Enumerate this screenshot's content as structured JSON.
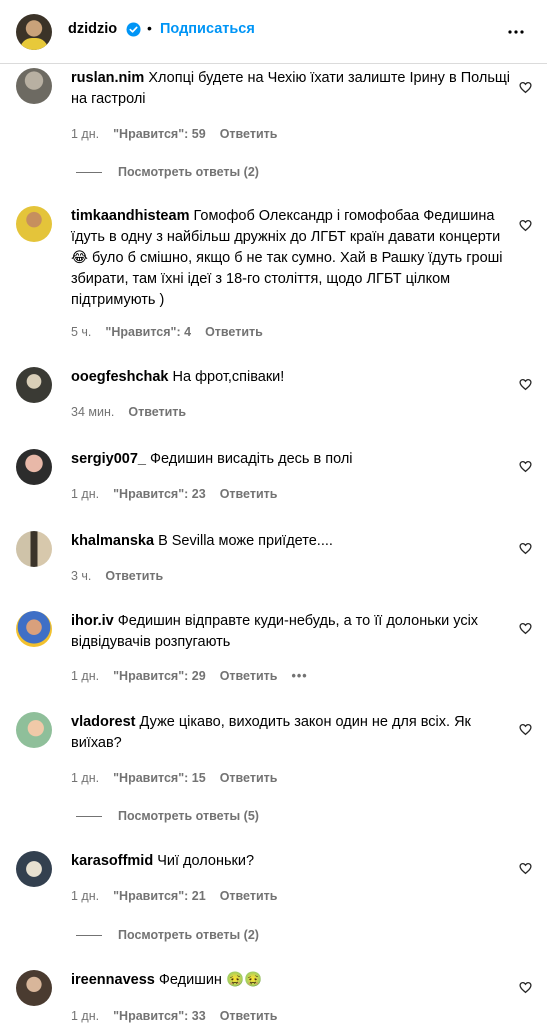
{
  "header": {
    "username": "dzidzio",
    "separator": "•",
    "follow_label": "Подписаться"
  },
  "comments": [
    {
      "username": "ruslan.nim",
      "text": "Хлопці будете на Чехію їхати залиште Ірину в Польщі на гастролі",
      "time": "1 дн.",
      "likes": "\"Нравится\": 59",
      "reply": "Ответить",
      "view_replies": "Посмотреть ответы (2)"
    },
    {
      "username": "timkaandhisteam",
      "text_before": "Гомофоб Олександр і гомофобаа Федишина їдуть в одну з найбільш дружніх до ЛГБТ країн давати концерти",
      "emoji": "😂",
      "text_after": "було б смішно, якщо б не так сумно. Хай в Рашку їдуть гроші збирати, там їхні ідеї з 18-го століття, щодо ЛГБТ цілком підтримують )",
      "time": "5 ч.",
      "likes": "\"Нравится\": 4",
      "reply": "Ответить"
    },
    {
      "username": "ooegfeshchak",
      "text": "На фрот,співаки!",
      "time": "34 мин.",
      "reply": "Ответить"
    },
    {
      "username": "sergiy007_",
      "text": "Федишин висадіть десь в полі",
      "time": "1 дн.",
      "likes": "\"Нравится\": 23",
      "reply": "Ответить"
    },
    {
      "username": "khalmanska",
      "text": "В Sevilla може приїдете....",
      "time": "3 ч.",
      "reply": "Ответить"
    },
    {
      "username": "ihor.iv",
      "text": "Федишин відправте куди-небудь, а то її долоньки усіх відвідувачів розпугають",
      "time": "1 дн.",
      "likes": "\"Нравится\": 29",
      "reply": "Ответить",
      "more": "•••"
    },
    {
      "username": "vladorest",
      "text": "Дуже цікаво, виходить закон один не для всіх. Як виїхав?",
      "time": "1 дн.",
      "likes": "\"Нравится\": 15",
      "reply": "Ответить",
      "view_replies": "Посмотреть ответы (5)"
    },
    {
      "username": "karasoffmid",
      "text": "Чиї долоньки?",
      "time": "1 дн.",
      "likes": "\"Нравится\": 21",
      "reply": "Ответить",
      "view_replies": "Посмотреть ответы (2)"
    },
    {
      "username": "ireennavess",
      "text": "Федишин",
      "emoji": "🤢🤢",
      "time": "1 дн.",
      "likes": "\"Нравится\": 33",
      "reply": "Ответить"
    }
  ],
  "colors": {
    "accent": "#0095f6",
    "muted": "#737373",
    "border": "#dbdbdb"
  },
  "icons": [
    "verified-badge-icon",
    "more-options-icon",
    "heart-outline-icon"
  ]
}
